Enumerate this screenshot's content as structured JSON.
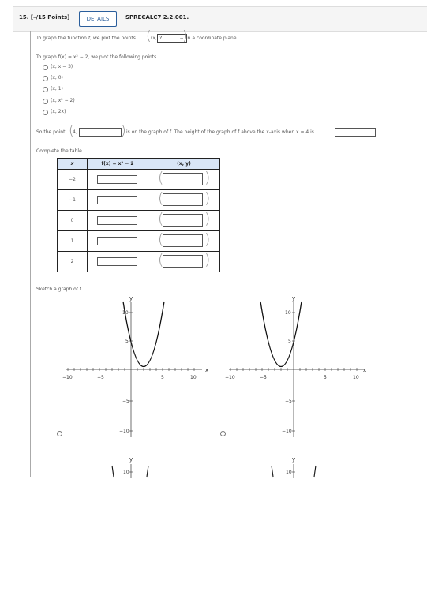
{
  "header": {
    "question_number": "15.  [–/15 Points]",
    "details_button": "DETAILS",
    "problem_code": "SPRECALC7 2.2.001."
  },
  "intro": {
    "prefix": "To graph the function ",
    "f": "f",
    "middle": ", we plot the points ",
    "point_open": "(x, ",
    "dropdown_value": "?",
    "suffix": " in a coordinate plane."
  },
  "options_prompt": "To graph f(x) = x² − 2, we plot the following points.",
  "options": [
    "(x, x − 3)",
    "(x, 0)",
    "(x, 1)",
    "(x, x² − 2)",
    "(x, 2x)"
  ],
  "point_sentence": {
    "prefix": "So the point ",
    "point_start": "4,",
    "middle": " is on the graph of f. The height of the graph of f above the x-axis when x = 4 is",
    "end": "."
  },
  "table": {
    "prompt": "Complete the table.",
    "headers": [
      "x",
      "f(x) = x² − 2",
      "(x, y)"
    ],
    "x_values": [
      "−2",
      "−1",
      "0",
      "1",
      "2"
    ]
  },
  "sketch_prompt": "Sketch a graph of f.",
  "graphs": {
    "x_label": "x",
    "y_label": "y",
    "x_ticks": [
      "−10",
      "−5",
      "5",
      "10"
    ],
    "y_ticks_pos": [
      "10",
      "5"
    ],
    "y_ticks_neg": [
      "−5",
      "−10"
    ],
    "options": [
      {
        "curve": "y = (x − 2)²",
        "selected": false
      },
      {
        "curve": "y = (x + 2)²",
        "selected": false
      }
    ]
  }
}
